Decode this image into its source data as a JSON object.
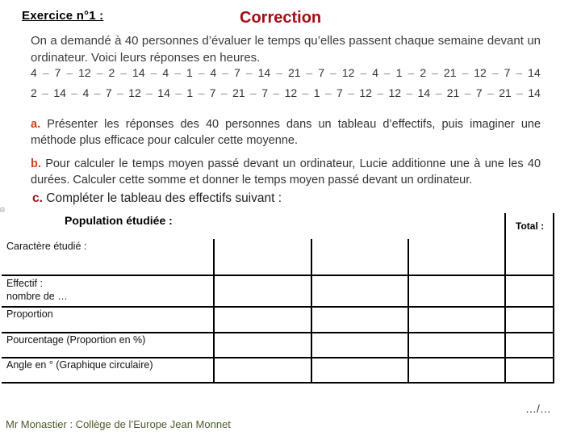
{
  "header": {
    "exercise_title": "Exercice n°1 :",
    "correction_label": "Correction",
    "colors": {
      "correction": "#a30e16",
      "question_label_ab": "#c8421a",
      "question_label_c": "#a30e16",
      "footer": "#4a5a2a"
    }
  },
  "intro": "On a demandé à 40 personnes d’évaluer le temps qu’elles passent chaque semaine devant un ordinateur. Voici leurs réponses en heures.",
  "responses": {
    "row1": [
      "4",
      "7",
      "12",
      "2",
      "14",
      "4",
      "1",
      "4",
      "7",
      "14",
      "21",
      "7",
      "12",
      "4",
      "1",
      "2",
      "21",
      "12",
      "7",
      "14"
    ],
    "row2": [
      "2",
      "14",
      "4",
      "7",
      "12",
      "14",
      "1",
      "7",
      "21",
      "7",
      "12",
      "1",
      "7",
      "12",
      "12",
      "14",
      "21",
      "7",
      "21",
      "14"
    ],
    "separator": "–"
  },
  "questions": {
    "a": {
      "label": "a.",
      "text": "Présenter les réponses des 40 personnes dans un tableau d’effectifs, puis imaginer une méthode plus efficace pour calculer cette moyenne."
    },
    "b": {
      "label": "b.",
      "text": "Pour calculer le temps moyen passé devant un ordinateur, Lucie additionne une à une les 40 durées. Calculer cette somme et donner le temps moyen passé devant un ordinateur."
    },
    "c": {
      "label": "c.",
      "text": "Compléter le tableau des effectifs suivant :"
    }
  },
  "table": {
    "population_label": "Population étudiée :",
    "total_label": "Total :",
    "rows": [
      {
        "line1": "Caractère étudié :",
        "line2": ""
      },
      {
        "line1": "Effectif :",
        "line2": "nombre de  …"
      },
      {
        "line1": "Proportion",
        "line2": ""
      },
      {
        "line1": "Pourcentage  (Proportion en %)",
        "line2": ""
      },
      {
        "line1": "Angle en ° (Graphique circulaire)",
        "line2": ""
      }
    ]
  },
  "footer": {
    "author": "Mr Monastier : Collège de l’Europe Jean Monnet",
    "pager": "…/…"
  }
}
